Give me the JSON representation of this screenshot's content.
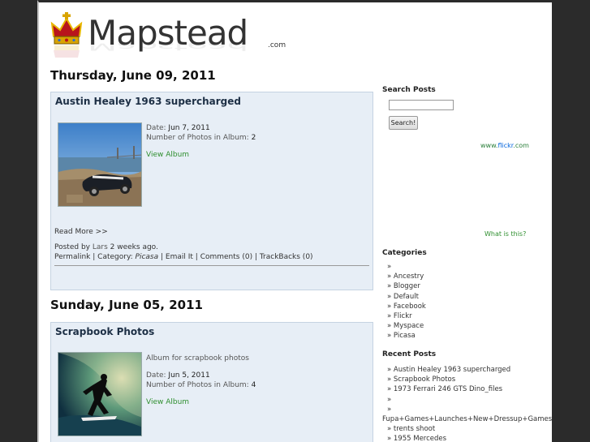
{
  "brand": {
    "name": "Mapstead",
    "suffix": ".com"
  },
  "posts": [
    {
      "day": "Thursday, June 09, 2011",
      "title": "Austin Healey 1963 supercharged",
      "description": "",
      "date_label": "Date:",
      "date": "Jun 7, 2011",
      "photos_label": "Number of Photos in Album:",
      "photos": "2",
      "view_album": "View Album",
      "read_more": "Read More >>",
      "posted_by_prefix": "Posted by",
      "author": "Lars",
      "posted_ago": "2 weeks ago.",
      "permalink": "Permalink",
      "category_label": "Category:",
      "category": "Picasa",
      "email": "Email It",
      "comments": "Comments (0)",
      "trackbacks": "TrackBacks (0)"
    },
    {
      "day": "Sunday, June 05, 2011",
      "title": "Scrapbook Photos",
      "description": "Album for scrapbook photos",
      "date_label": "Date:",
      "date": "Jun 5, 2011",
      "photos_label": "Number of Photos in Album:",
      "photos": "4",
      "view_album": "View Album"
    }
  ],
  "sidebar": {
    "search_title": "Search Posts",
    "search_button": "Search!",
    "search_value": "",
    "flickr_www": "www.",
    "flickr_brand": "flickr",
    "flickr_com": ".com",
    "what_is_this": "What is this?",
    "categories_title": "Categories",
    "categories": [
      "»",
      "» Ancestry",
      "» Blogger",
      "» Default",
      "» Facebook",
      "» Flickr",
      "» Myspace",
      "» Picasa"
    ],
    "recent_title": "Recent Posts",
    "recent": [
      "» Austin Healey 1963 supercharged",
      "» Scrapbook Photos",
      "» 1973 Ferrari 246 GTS Dino_files",
      "»",
      "»",
      "Fupa+Games+Launches+New+Dressup+Games+and+",
      "» trents shoot",
      "» 1955 Mercedes"
    ]
  },
  "colors": {
    "post_bg": "#e7eef6",
    "link_green": "#2f8f2f",
    "page_bg": "#2b2b2b"
  }
}
